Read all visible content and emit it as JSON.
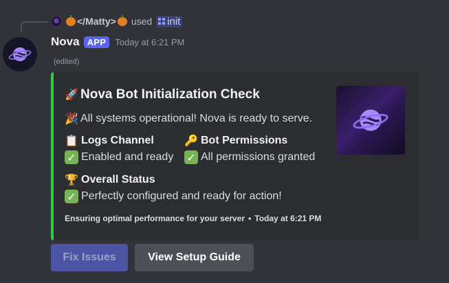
{
  "reply": {
    "user": "</Matty>",
    "action": "used",
    "command": "init",
    "command_icon": "slash-command-icon"
  },
  "message": {
    "author": "Nova",
    "badge": "APP",
    "timestamp": "Today at 6:21 PM",
    "edited": "(edited)"
  },
  "embed": {
    "accent_color": "#2ecc40",
    "title": "Nova Bot Initialization Check",
    "title_icon": "rocket-icon",
    "description": "All systems operational! Nova is ready to serve.",
    "description_icon": "party-popper-icon",
    "fields": [
      {
        "icon": "clipboard-icon",
        "name": "Logs Channel",
        "value": "Enabled and ready"
      },
      {
        "icon": "key-icon",
        "name": "Bot Permissions",
        "value": "All permissions granted"
      },
      {
        "icon": "trophy-icon",
        "name": "Overall Status",
        "value": "Perfectly configured and ready for action!"
      }
    ],
    "footer": {
      "text": "Ensuring optimal performance for your server",
      "separator": "•",
      "timestamp": "Today at 6:21 PM"
    }
  },
  "buttons": {
    "fix_issues": "Fix Issues",
    "setup_guide": "View Setup Guide"
  },
  "colors": {
    "background": "#323339",
    "embed_bg": "#2b2d31",
    "blurple": "#5865f2",
    "check_green": "#77b255"
  }
}
